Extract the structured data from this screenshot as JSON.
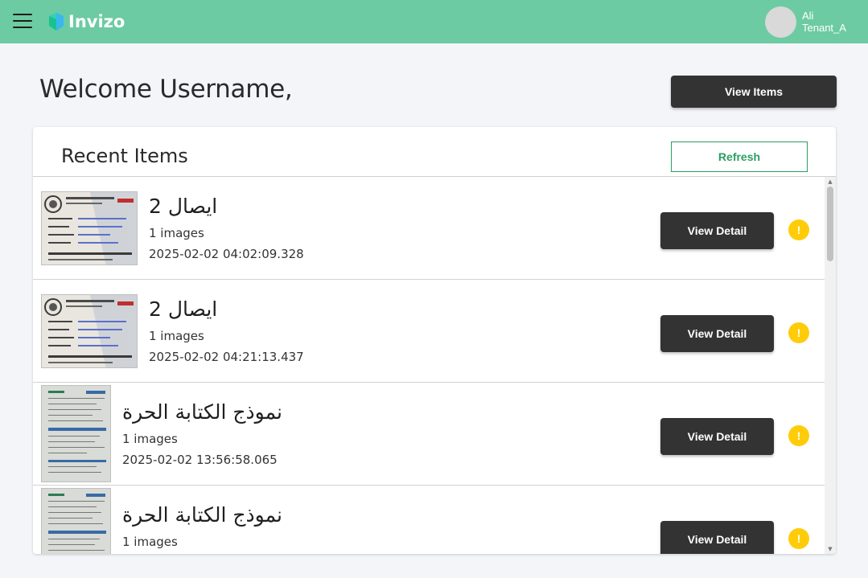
{
  "header": {
    "menu_icon": "hamburger-menu-icon",
    "brand": "Invizo",
    "logo_icon": "invizo-logo-icon",
    "user_name": "Ali",
    "tenant": "Tenant_A",
    "colors": {
      "header_bg": "#6ccba2"
    }
  },
  "main": {
    "welcome": "Welcome Username,",
    "view_items_label": "View Items"
  },
  "recent": {
    "title": "Recent Items",
    "refresh_label": "Refresh",
    "colors": {
      "refresh": "#2a9d62",
      "warning": "#ffcc0a",
      "button": "#333333"
    },
    "items": [
      {
        "title": "ايصال 2",
        "images": "1 images",
        "date": "2025-02-02 04:02:09.328",
        "detail_label": "View Detail",
        "status_icon": "warning-icon",
        "status_glyph": "!"
      },
      {
        "title": "ايصال 2",
        "images": "1 images",
        "date": "2025-02-02 04:21:13.437",
        "detail_label": "View Detail",
        "status_icon": "warning-icon",
        "status_glyph": "!"
      },
      {
        "title": "نموذج الكتابة الحرة",
        "images": "1 images",
        "date": "2025-02-02 13:56:58.065",
        "detail_label": "View Detail",
        "status_icon": "warning-icon",
        "status_glyph": "!"
      },
      {
        "title": "نموذج الكتابة الحرة",
        "images": "1 images",
        "date": "",
        "detail_label": "View Detail",
        "status_icon": "warning-icon",
        "status_glyph": "!"
      }
    ]
  }
}
